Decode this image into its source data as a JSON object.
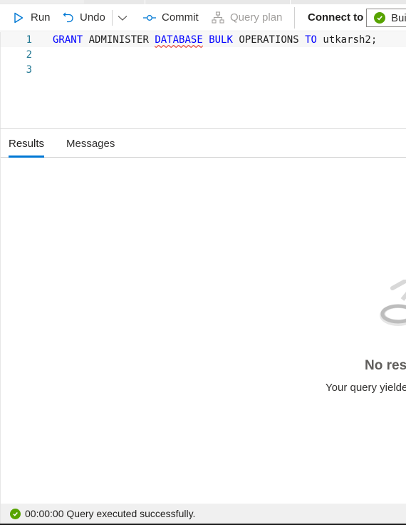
{
  "toolbar": {
    "run_label": "Run",
    "undo_label": "Undo",
    "commit_label": "Commit",
    "query_plan_label": "Query plan",
    "connect_to_label": "Connect to",
    "database_value": "Bui"
  },
  "editor": {
    "lines": [
      {
        "number": "1",
        "tokens": [
          "GRANT",
          "ADMINISTER",
          "DATABASE",
          "BULK",
          "OPERATIONS",
          "TO",
          "utkarsh2;"
        ]
      },
      {
        "number": "2"
      },
      {
        "number": "3"
      }
    ]
  },
  "tabs": {
    "results": "Results",
    "messages": "Messages",
    "active": "Results"
  },
  "results": {
    "empty_title": "No resu",
    "empty_subtitle": "Your query yielded"
  },
  "status": {
    "time": "00:00:00",
    "message": "Query executed successfully.",
    "icon": "success-check-icon",
    "color": "#57a300"
  },
  "colors": {
    "accent": "#0078d4",
    "keyword": "#0000ff",
    "line_number": "#237893",
    "error_squiggle": "#e51400",
    "success": "#57a300"
  }
}
